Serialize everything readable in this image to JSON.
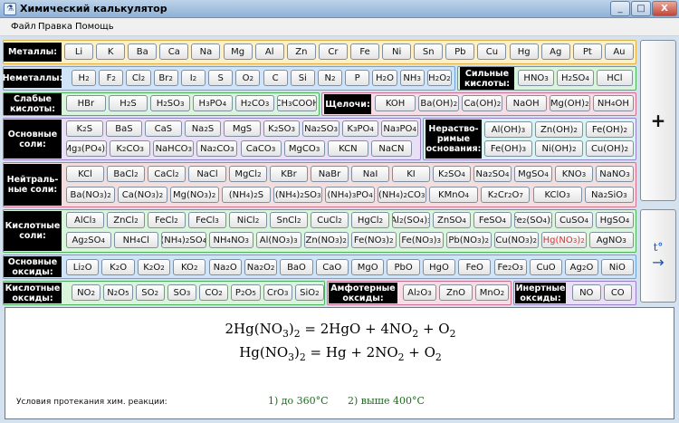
{
  "window": {
    "title": "Химический калькулятор",
    "min": "_",
    "max": "□",
    "close": "X",
    "app_icon": "flask-icon"
  },
  "menu": [
    "Файл",
    "Правка",
    "Помощь"
  ],
  "metals": {
    "label": "Металлы:",
    "items": [
      "Li",
      "K",
      "Ba",
      "Ca",
      "Na",
      "Mg",
      "Al",
      "Zn",
      "Cr",
      "Fe",
      "Ni",
      "Sn",
      "Pb",
      "Cu",
      "Hg",
      "Ag",
      "Pt",
      "Au"
    ]
  },
  "nonmetals": {
    "label": "Неметаллы:",
    "items": [
      "H2",
      "F2",
      "Cl2",
      "Br2",
      "I2",
      "S",
      "O2",
      "C",
      "Si",
      "N2",
      "P",
      "H2O",
      "NH3",
      "H2O2"
    ]
  },
  "strong_acids": {
    "label": "Сильные кислоты:",
    "items": [
      "HNO3",
      "H2SO4",
      "HCl"
    ]
  },
  "weak_acids": {
    "label": "Слабые кислоты:",
    "items": [
      "HBr",
      "H2S",
      "H2SO3",
      "H3PO4",
      "H2CO3",
      "CH3COOH"
    ]
  },
  "alkali": {
    "label": "Щелочи:",
    "items": [
      "KOH",
      "Ba(OH)2",
      "Ca(OH)2",
      "NaOH",
      "Mg(OH)2",
      "NH4OH"
    ]
  },
  "basic_salts": {
    "label": "Основные соли:",
    "row1": [
      "K2S",
      "BaS",
      "CaS",
      "Na2S",
      "MgS",
      "K2SO3",
      "Na2SO3",
      "K3PO4",
      "Na3PO4"
    ],
    "row2": [
      "Mg3(PO4)2",
      "K2CO3",
      "NaHCO3",
      "Na2CO3",
      "CaCO3",
      "MgCO3",
      "KCN",
      "NaCN"
    ]
  },
  "insoluble_bases": {
    "label": "Нераство-римые основания:",
    "row1": [
      "Al(OH)3",
      "Zn(OH)2",
      "Fe(OH)2"
    ],
    "row2": [
      "Fe(OH)3",
      "Ni(OH)2",
      "Cu(OH)2"
    ]
  },
  "neutral_salts": {
    "label": "Нейтраль-ные соли:",
    "row1": [
      "KCl",
      "BaCl2",
      "CaCl2",
      "NaCl",
      "MgCl2",
      "KBr",
      "NaBr",
      "NaI",
      "KI",
      "K2SO4",
      "Na2SO4",
      "MgSO4",
      "KNO3",
      "NaNO3"
    ],
    "row2": [
      "Ba(NO3)2",
      "Ca(NO3)2",
      "Mg(NO3)2",
      "(NH4)2S",
      "(NH4)2SO3",
      "(NH4)3PO4",
      "(NH4)2CO3",
      "KMnO4",
      "K2Cr2O7",
      "KClO3",
      "Na2SiO3"
    ]
  },
  "acidic_salts": {
    "label": "Кислотные соли:",
    "row1": [
      "AlCl3",
      "ZnCl2",
      "FeCl2",
      "FeCl3",
      "NiCl2",
      "SnCl2",
      "CuCl2",
      "HgCl2",
      "Al2(SO4)3",
      "ZnSO4",
      "FeSO4",
      "Fe2(SO4)3",
      "CuSO4",
      "HgSO4"
    ],
    "row2": [
      "Ag2SO4",
      "NH4Cl",
      "(NH4)2SO4",
      "NH4NO3",
      "Al(NO3)3",
      "Zn(NO3)2",
      "Fe(NO3)2",
      "Fe(NO3)3",
      "Pb(NO3)2",
      "Cu(NO3)2",
      "Hg(NO3)2",
      "AgNO3"
    ],
    "selected": "Hg(NO3)2"
  },
  "basic_oxides": {
    "label": "Основные оксиды:",
    "items": [
      "Li2O",
      "K2O",
      "K2O2",
      "KO2",
      "Na2O",
      "Na2O2",
      "BaO",
      "CaO",
      "MgO",
      "PbO",
      "HgO",
      "FeO",
      "Fe2O3",
      "CuO",
      "Ag2O",
      "NiO"
    ]
  },
  "acidic_oxides": {
    "label": "Кислотные оксиды:",
    "items": [
      "NO2",
      "N2O5",
      "SO2",
      "SO3",
      "CO2",
      "P2O5",
      "CrO3",
      "SiO2"
    ]
  },
  "amphoteric_oxides": {
    "label": "Амфотерные оксиды:",
    "items": [
      "Al2O3",
      "ZnO",
      "MnO2"
    ]
  },
  "inert_oxides": {
    "label": "Инертные оксиды:",
    "items": [
      "NO",
      "CO"
    ]
  },
  "side": {
    "plus": "+",
    "heat_label": "t°",
    "heat_arrow": "→"
  },
  "output": {
    "eq1": "2Hg(NO3)2 = 2HgO + 4NO2 + O2",
    "eq2": "Hg(NO3)2 = Hg + 2NO2 + O2",
    "conditions_label": "Условия протекания хим. реакции:",
    "cond1": "1) до 360°C",
    "cond2": "2) выше 400°C"
  },
  "colors": {
    "metals_bg": "#fdf0c8",
    "metals_border": "#e0b040",
    "nonmetals_bg": "#cfe4f8",
    "nonmetals_border": "#6aa4d8",
    "acids_bg": "#d9f5dc",
    "acids_border": "#50b060",
    "alkali_bg": "#f8dde4",
    "alkali_border": "#d07090",
    "salts_bg": "#e9e0f6",
    "salts_border": "#9a80c8",
    "bases_bg": "#d9f4f4",
    "neutral_bg": "#f2dede",
    "acidsalt_bg": "#d9f5dc",
    "oxide_bg": "#cfe4f8",
    "acidoxide_bg": "#d9f5dc",
    "ampho_bg": "#f8dde4",
    "inert_bg": "#e9e0f6",
    "selected_text": "#e03030"
  }
}
